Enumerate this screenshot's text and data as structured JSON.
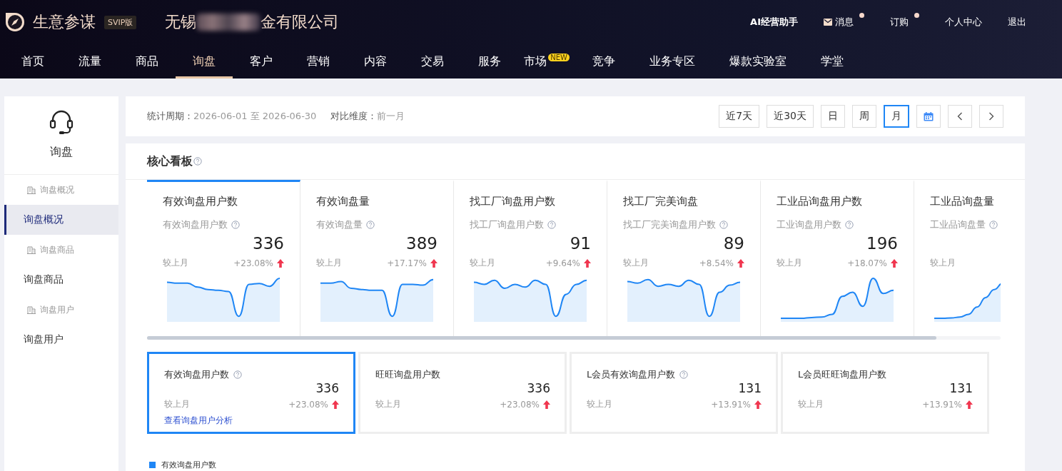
{
  "header": {
    "brand": "生意参谋",
    "edition": "SVIP版",
    "company_parts": [
      "无锡",
      "金有限公司"
    ],
    "links": [
      {
        "label": "AI经营助手",
        "kind": "text",
        "dot": false
      },
      {
        "label": "消息",
        "kind": "mail",
        "dot": true
      },
      {
        "label": "订购",
        "kind": "text",
        "dot": true
      },
      {
        "label": "个人中心",
        "kind": "text",
        "dot": false
      },
      {
        "label": "退出",
        "kind": "text",
        "dot": false
      }
    ]
  },
  "nav": [
    {
      "label": "首页",
      "selected": false
    },
    {
      "label": "流量",
      "selected": false
    },
    {
      "label": "商品",
      "selected": false
    },
    {
      "label": "询盘",
      "selected": true
    },
    {
      "label": "客户",
      "selected": false
    },
    {
      "label": "营销",
      "selected": false
    },
    {
      "label": "内容",
      "selected": false
    },
    {
      "label": "交易",
      "selected": false
    },
    {
      "label": "服务",
      "selected": false
    },
    {
      "label": "市场",
      "selected": false,
      "badge": "NEW"
    },
    {
      "label": "竞争",
      "selected": false
    },
    {
      "label": "业务专区",
      "selected": false
    },
    {
      "label": "爆款实验室",
      "selected": false
    },
    {
      "label": "学堂",
      "selected": false
    }
  ],
  "sidebar": {
    "title": "询盘",
    "items": [
      {
        "label": "询盘概况",
        "kind": "section",
        "selected": false
      },
      {
        "label": "询盘概况",
        "kind": "page",
        "selected": true
      },
      {
        "label": "询盘商品",
        "kind": "section",
        "selected": false
      },
      {
        "label": "询盘商品",
        "kind": "page",
        "selected": false
      },
      {
        "label": "询盘用户",
        "kind": "section",
        "selected": false
      },
      {
        "label": "询盘用户",
        "kind": "page",
        "selected": false
      }
    ]
  },
  "period": {
    "label": "统计周期：",
    "value": "2026-06-01 至 2026-06-30",
    "compare_label": "对比维度：",
    "compare_value": "前一月",
    "buttons": [
      {
        "kind": "text",
        "label": "近7天",
        "selected": false
      },
      {
        "kind": "text",
        "label": "近30天",
        "selected": false
      },
      {
        "kind": "text",
        "label": "日",
        "selected": false
      },
      {
        "kind": "text",
        "label": "周",
        "selected": false
      },
      {
        "kind": "text",
        "label": "月",
        "selected": true
      },
      {
        "kind": "calendar",
        "selected": false
      },
      {
        "kind": "prev",
        "selected": false
      },
      {
        "kind": "next",
        "selected": false
      }
    ]
  },
  "board": {
    "title": "核心看板",
    "metrics": [
      {
        "title": "有效询盘用户数",
        "sub": "有效询盘用户数",
        "value": "336",
        "compare": "较上月",
        "change": "+23.08%",
        "selected": true
      },
      {
        "title": "有效询盘量",
        "sub": "有效询盘量",
        "value": "389",
        "compare": "较上月",
        "change": "+17.17%",
        "selected": false
      },
      {
        "title": "找工厂询盘用户数",
        "sub": "找工厂询盘用户数",
        "value": "91",
        "compare": "较上月",
        "change": "+9.64%",
        "selected": false
      },
      {
        "title": "找工厂完美询盘",
        "sub": "找工厂完美询盘用户数",
        "value": "89",
        "compare": "较上月",
        "change": "+8.54%",
        "selected": false
      },
      {
        "title": "工业品询盘用户数",
        "sub": "工业询盘用户数",
        "value": "196",
        "compare": "较上月",
        "change": "+18.07%",
        "selected": false
      },
      {
        "title": "工业品询盘量",
        "sub": "工业品询盘量",
        "compare": "较上月",
        "selected": false
      }
    ],
    "details": [
      {
        "title": "有效询盘用户数",
        "help": true,
        "value": "336",
        "compare": "较上月",
        "change": "+23.08%",
        "link": "查看询盘用户分析",
        "selected": true
      },
      {
        "title": "旺旺询盘用户数",
        "help": false,
        "value": "336",
        "compare": "较上月",
        "change": "+23.08%",
        "selected": false
      },
      {
        "title": "L会员有效询盘用户数",
        "help": true,
        "value": "131",
        "compare": "较上月",
        "change": "+13.91%",
        "selected": false
      },
      {
        "title": "L会员旺旺询盘用户数",
        "help": false,
        "value": "131",
        "compare": "较上月",
        "change": "+13.91%",
        "selected": false
      }
    ],
    "legend": {
      "label": "有效询盘用户数",
      "color": "#1f86f5"
    }
  }
}
